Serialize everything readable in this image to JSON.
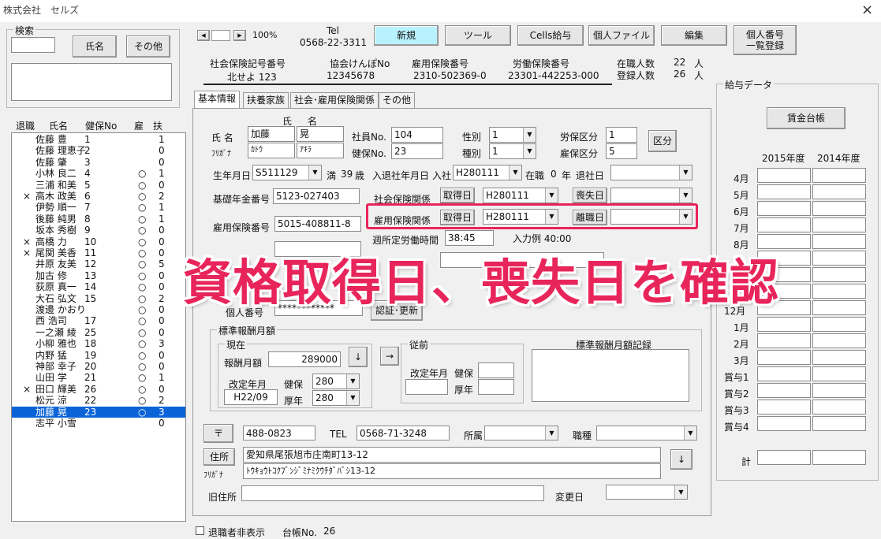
{
  "window": {
    "title": "株式会社　セルズ",
    "close": "×"
  },
  "search": {
    "label": "検索",
    "name_btn": "氏名",
    "other_btn": "その他"
  },
  "list": {
    "headers": [
      "退職",
      "氏名",
      "健保No",
      "雇",
      "扶"
    ],
    "rows": [
      {
        "ret": "",
        "name": "佐藤 豊",
        "no": "1",
        "koyo": "",
        "fu": "1"
      },
      {
        "ret": "",
        "name": "佐藤 理恵子",
        "no": "2",
        "koyo": "",
        "fu": "0"
      },
      {
        "ret": "",
        "name": "佐藤 肇",
        "no": "3",
        "koyo": "",
        "fu": "0"
      },
      {
        "ret": "",
        "name": "小林 良二",
        "no": "4",
        "koyo": "○",
        "fu": "1"
      },
      {
        "ret": "",
        "name": "三浦 和美",
        "no": "5",
        "koyo": "○",
        "fu": "0"
      },
      {
        "ret": "×",
        "name": "高木 政美",
        "no": "6",
        "koyo": "○",
        "fu": "2"
      },
      {
        "ret": "",
        "name": "伊勢 順一",
        "no": "7",
        "koyo": "○",
        "fu": "1"
      },
      {
        "ret": "",
        "name": "後藤 純男",
        "no": "8",
        "koyo": "○",
        "fu": "1"
      },
      {
        "ret": "",
        "name": "坂本 秀樹",
        "no": "9",
        "koyo": "○",
        "fu": "0"
      },
      {
        "ret": "×",
        "name": "高橋 力",
        "no": "10",
        "koyo": "○",
        "fu": "0"
      },
      {
        "ret": "×",
        "name": "尾関 美香",
        "no": "11",
        "koyo": "○",
        "fu": "0"
      },
      {
        "ret": "",
        "name": "井原 友美",
        "no": "12",
        "koyo": "○",
        "fu": "5"
      },
      {
        "ret": "",
        "name": "加古 修",
        "no": "13",
        "koyo": "○",
        "fu": "0"
      },
      {
        "ret": "",
        "name": "荻原 真一",
        "no": "14",
        "koyo": "○",
        "fu": "0"
      },
      {
        "ret": "",
        "name": "大石 弘文",
        "no": "15",
        "koyo": "○",
        "fu": "2"
      },
      {
        "ret": "",
        "name": "渡邊 かおり",
        "no": "",
        "koyo": "○",
        "fu": "0"
      },
      {
        "ret": "",
        "name": "西 浩司",
        "no": "17",
        "koyo": "○",
        "fu": "0"
      },
      {
        "ret": "",
        "name": "一之瀬 綾",
        "no": "25",
        "koyo": "○",
        "fu": "0"
      },
      {
        "ret": "",
        "name": "小柳 雅也",
        "no": "18",
        "koyo": "○",
        "fu": "3"
      },
      {
        "ret": "",
        "name": "内野 猛",
        "no": "19",
        "koyo": "○",
        "fu": "0"
      },
      {
        "ret": "",
        "name": "神部 幸子",
        "no": "20",
        "koyo": "○",
        "fu": "0"
      },
      {
        "ret": "",
        "name": "山田 学",
        "no": "21",
        "koyo": "○",
        "fu": "1"
      },
      {
        "ret": "×",
        "name": "田口 輝美",
        "no": "26",
        "koyo": "○",
        "fu": "0"
      },
      {
        "ret": "",
        "name": "松元 涼",
        "no": "22",
        "koyo": "○",
        "fu": "2"
      },
      {
        "ret": "",
        "name": "加藤 晃",
        "no": "23",
        "koyo": "○",
        "fu": "3"
      },
      {
        "ret": "",
        "name": "志平 小雪",
        "no": "",
        "koyo": "",
        "fu": "0"
      }
    ],
    "selected_index": 24
  },
  "toolbar": {
    "prev": "◀",
    "next": "▶",
    "zoom": "100%",
    "tel_label": "Tel",
    "tel": "0568-22-3311",
    "new": "新規",
    "tool": "ツール",
    "cells": "Cells給与",
    "personal_file": "個人ファイル",
    "edit": "編集",
    "mynum_line1": "個人番号",
    "mynum_line2": "一覧登録"
  },
  "company": {
    "shaho_label": "社会保険記号番号",
    "shaho": "北せよ 123",
    "kyokai_label": "協会けんぽNo",
    "kyokai": "12345678",
    "koyo_label": "雇用保険番号",
    "koyo": "2310-502369-0",
    "rodo_label": "労働保険番号",
    "rodo": "23301-442253-000",
    "zaishoku_label": "在職人数",
    "zaishoku": "22",
    "toroku_label": "登録人数",
    "toroku": "26",
    "unit": "人"
  },
  "tabs": [
    "基本情報",
    "扶養家族",
    "社会･雇用保険関係",
    "その他"
  ],
  "basic": {
    "shi": "氏",
    "mei": "名",
    "name_label": "氏 名",
    "kana_label": "ﾌﾘｶﾞﾅ",
    "last": "加藤",
    "first": "晃",
    "last_kana": "ｶﾄｳ",
    "first_kana": "ｱｷﾗ",
    "emp_no_label": "社員No.",
    "emp_no": "104",
    "kenpo_no_label": "健保No.",
    "kenpo_no": "23",
    "sex_label": "性別",
    "sex": "1",
    "kind_label": "種別",
    "kind": "1",
    "rouho_label": "労保区分",
    "rouho": "1",
    "koho_label": "雇保区分",
    "koho": "5",
    "kubun_btn": "区分",
    "birth_label": "生年月日",
    "birth": "S511129",
    "age_prefix": "満",
    "age": "39",
    "age_suffix": "歳",
    "join_label": "入退社年月日",
    "join_in": "入社",
    "join": "H280111",
    "zaishoku": "在職",
    "years": "0",
    "year_unit": "年",
    "leave_label": "退社日",
    "pension_label": "基礎年金番号",
    "pension": "5123-027403",
    "shakai_label": "社会保険関係",
    "get_btn": "取得日",
    "shakai_get": "H280111",
    "lose_btn": "喪失日",
    "koyo_num_label": "雇用保険番号",
    "koyo_num": "5015-408811-8",
    "koyo_rel_label": "雇用保険関係",
    "koyo_get_btn": "取得日",
    "koyo_get": "H280111",
    "koyo_leave_btn": "離職日",
    "weekly_label": "週所定労働時間",
    "weekly": "38:45",
    "input_example": "入力例 40:00",
    "mynum_label": "個人番号",
    "mynum": "************",
    "auth_btn": "認証･更新"
  },
  "salary_std": {
    "group": "標準報酬月額",
    "current": "現在",
    "prev": "従前",
    "record": "標準報酬月額記録",
    "monthly_label": "報酬月額",
    "monthly": "289000",
    "revise_label": "改定年月",
    "revise": "H22/09",
    "kenpo_label": "健保",
    "kenpo": "280",
    "kosei_label": "厚年",
    "kosei": "280",
    "prev_revise": "改定年月",
    "prev_kenpo": "健保",
    "prev_kosei": "厚年",
    "down_arrow": "↓",
    "right_arrow": "→"
  },
  "address": {
    "zip_btn": "〒",
    "zip": "488-0823",
    "tel_label": "TEL",
    "tel": "0568-71-3248",
    "dept_label": "所属",
    "job_label": "職種",
    "addr_btn": "住所",
    "addr": "愛知県尾張旭市庄南町13-12",
    "kana_label": "ﾌﾘｶﾞﾅ",
    "addr_kana": "ﾄｳｷｮｳﾄｺｸﾌﾞﾝｼﾞﾐﾅﾐｸｳﾁﾀﾞﾊﾞｼ13-12",
    "old_label": "旧住所",
    "change_label": "変更日",
    "down": "↓"
  },
  "payroll": {
    "group": "給与データ",
    "ledger_btn": "賃金台帳",
    "year1": "2015年度",
    "year2": "2014年度",
    "months": [
      "4月",
      "5月",
      "6月",
      "7月",
      "8月",
      "",
      "",
      "",
      "12月",
      "1月",
      "2月",
      "3月",
      "賞与1",
      "賞与2",
      "賞与3",
      "賞与4"
    ],
    "total": "計"
  },
  "footer": {
    "hide_label": "退職者非表示",
    "ledger_label": "台帳No.",
    "ledger_no": "26"
  },
  "overlay": {
    "text": "資格取得日、喪失日を確認"
  },
  "colors": {
    "accent": "#e8255a",
    "selected": "#0a64d7",
    "new_btn": "#b9f2ff"
  }
}
